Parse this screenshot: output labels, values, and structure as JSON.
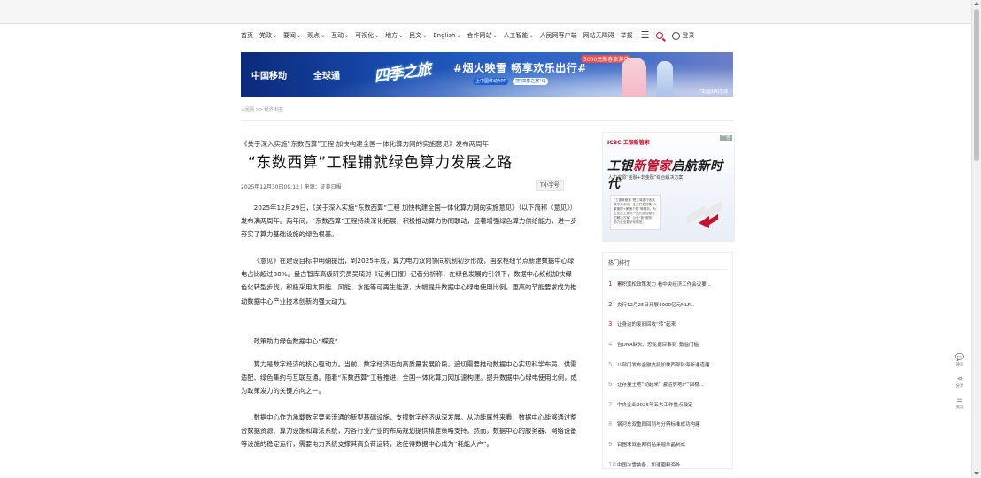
{
  "nav": {
    "items": [
      {
        "label": "首页",
        "dropdown": false
      },
      {
        "label": "党政",
        "dropdown": true
      },
      {
        "label": "要闻",
        "dropdown": true
      },
      {
        "label": "观点",
        "dropdown": true
      },
      {
        "label": "互动",
        "dropdown": true
      },
      {
        "label": "可视化",
        "dropdown": true
      },
      {
        "label": "地方",
        "dropdown": true
      },
      {
        "label": "民文",
        "dropdown": true
      },
      {
        "label": "English",
        "dropdown": true
      },
      {
        "label": "合作网站",
        "dropdown": true
      },
      {
        "label": "人工智能",
        "dropdown": true
      },
      {
        "label": "人民网客户端",
        "dropdown": false
      },
      {
        "label": "网站无障碍",
        "dropdown": false
      },
      {
        "label": "举报",
        "dropdown": false
      }
    ],
    "login_label": "登录"
  },
  "banner": {
    "logo1": "中国移动",
    "logo2": "全球通",
    "script": "四季之旅",
    "slogan": "#烟火映雪 畅享欢乐出行#",
    "app_button": "上中国移动APP",
    "app_button2": "搜\"四季之旅\"Q",
    "ribbon": "5000元新春旅游券",
    "ai_note": "*本图由AI生成"
  },
  "breadcrumb": "人民网 >> 经济·科技",
  "article": {
    "kicker": "《关于深入实施“东数西算”工程 加快构建全国一体化算力网的实施意见》发布两周年",
    "title": "“东数西算”工程铺就绿色算力发展之路",
    "meta": "2025年12月30日09:12 | 来源：证券日报",
    "font_size_label": "小字号",
    "paragraphs": {
      "p1": "2025年12月29日，《关于深入实施“东数西算”工程 加快构建全国一体化算力网的实施意见》（以下简称《意见》）发布满两周年。两年间，“东数西算”工程持续深化拓展，积极推动算力协同联动，显著增强绿色算力供给能力，进一步夯实了算力基础设施的绿色根基。",
      "p2": "《意见》在建设目标中明确提出，到2025年底，算力电力双向协同机制初步形成，国家枢纽节点新建数据中心绿电占比超过80%。盘古智库高级研究员吴琦对《证券日报》记者分析称，在绿色发展的引领下，数据中心纷纷加快绿色化转型步伐，积极采用太阳能、风能、水能等可再生能源，大幅提升数据中心绿电使用比例。更高的节能要求成为推动数据中心产业技术创新的强大动力。",
      "p3": "政策助力绿色数据中心“蝶变”",
      "p4": "算力是数字经济的核心驱动力。当前，数字经济迈向高质量发展阶段，追切需要推动数据中心实现科学布局、供需适配、绿色集约与互联互通。随着“东数西算”工程推进，全国一体化算力网加速构建。提升数据中心绿电使用比例，成为政策发力的关键方向之一。",
      "p5": "数据中心作为承载数字要素流通的新型基础设施，支撑数字经济纵深发展。从功能属性来看，数据中心能够通过整合数据资源、算力设施和算法系统，为各行业产业的布局规划提供精准策略支持。然而，数据中心的服务器、网络设备等设施的稳定运行，需要电力系统支撑其高负荷运转，这使得数据中心成为“耗能大户”。"
    }
  },
  "ad": {
    "tag": "广告",
    "brand": "ICBC 工银新管家",
    "headline_red": "新管家",
    "headline_prefix": "工银",
    "headline_suffix": "启航新时代",
    "sub": "人力资源“金融+非金融”综合解决方案",
    "card_text": "“工银新管家”是工商银行依托数字化手段，全力打造的集“人事管理+薪酬个税”等服务，为企业员工提供一站式综合服务的解决方案，以全“新”服务，助力企业数字化转型。"
  },
  "hot": {
    "title": "热门排行",
    "items": [
      {
        "rank": "1",
        "text": "累积宽松政策发力 看中央经济工作会议要..."
      },
      {
        "rank": "2",
        "text": "央行12月25日开展4000亿元MLF..."
      },
      {
        "rank": "3",
        "text": "让身边的废旧回收“转”起来"
      },
      {
        "rank": "4",
        "text": "告DNA缺失、恐龙据百事到“敷溢门槛”"
      },
      {
        "rank": "5",
        "text": "八部门发布金融支持加快西部陆海新通道建..."
      },
      {
        "rank": "6",
        "text": "让存量土地“动起来” 激活房地产“回稳..."
      },
      {
        "rank": "7",
        "text": "中央企业2026年五大工作重点敲定"
      },
      {
        "rank": "8",
        "text": "钢河东双重四回到与分辨标准成功构建"
      },
      {
        "rank": "9",
        "text": "百困来双金刚石钻采掘单晶制成"
      },
      {
        "rank": "10",
        "text": "中国冰雪装备，加速圈粉海外"
      }
    ]
  },
  "side_tools": {
    "comment": "评论",
    "share": "分享",
    "news": "资讯"
  },
  "colors": {
    "accent_red": "#d71920",
    "icbc_red": "#c8102e",
    "banner_blue": "#1a4fb5"
  }
}
